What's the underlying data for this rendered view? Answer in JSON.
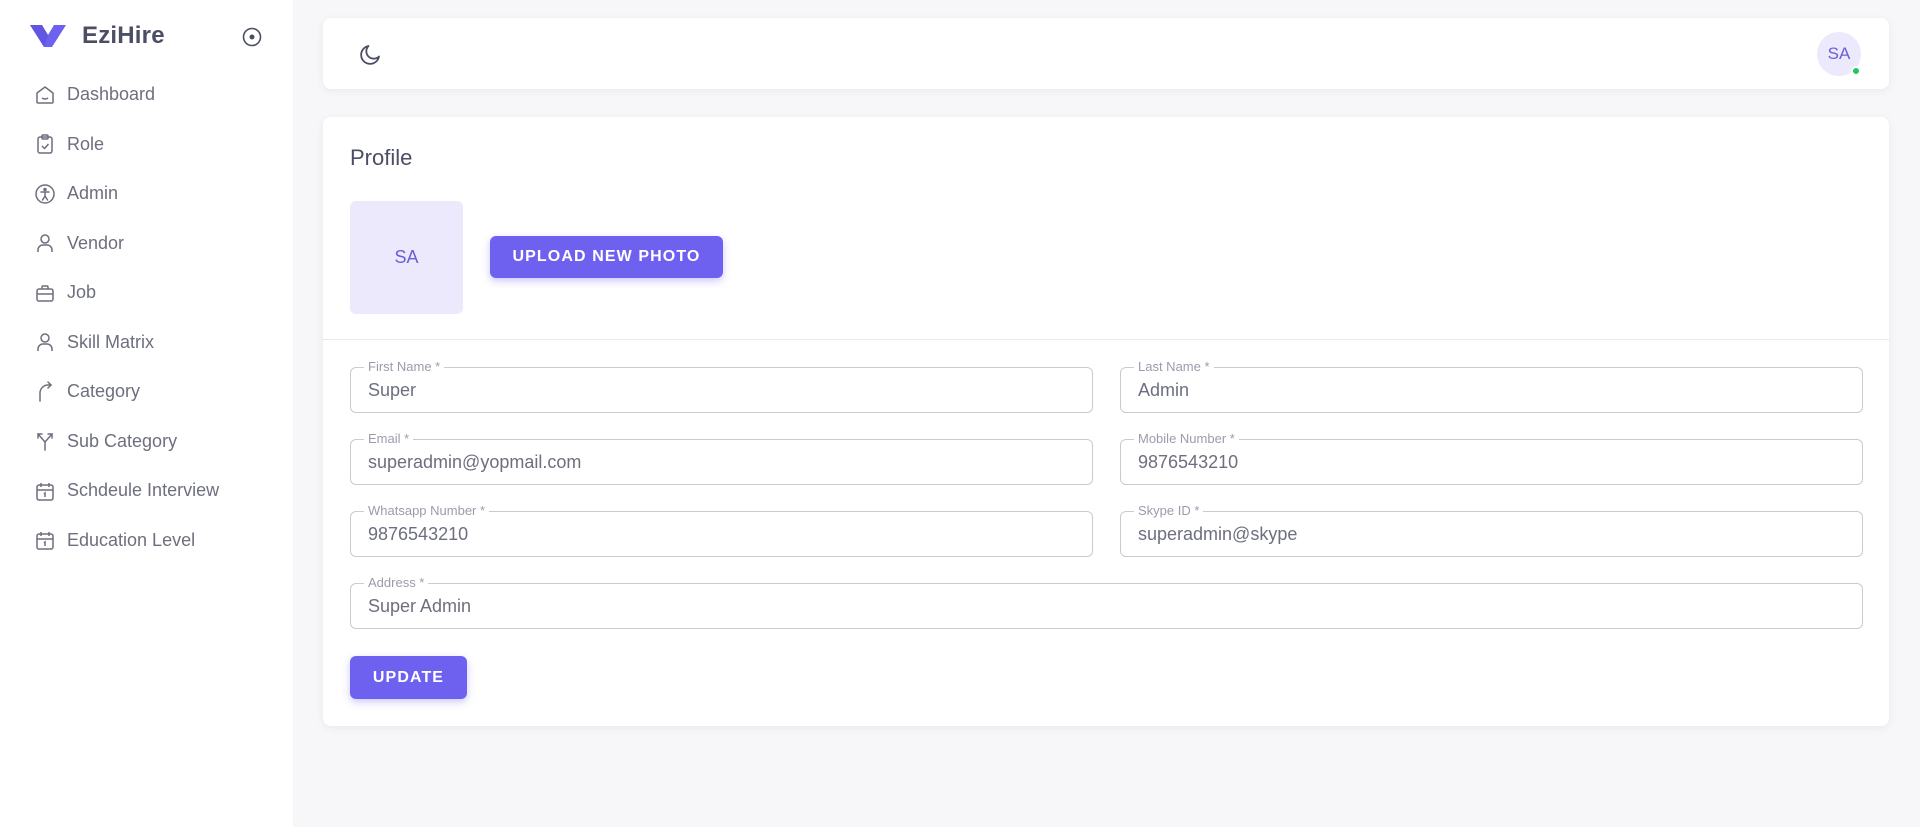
{
  "app": {
    "name": "EziHire"
  },
  "sidebar": {
    "items": [
      {
        "label": "Dashboard",
        "icon": "home-icon"
      },
      {
        "label": "Role",
        "icon": "clipboard-check-icon"
      },
      {
        "label": "Admin",
        "icon": "accessibility-icon"
      },
      {
        "label": "Vendor",
        "icon": "user-icon"
      },
      {
        "label": "Job",
        "icon": "briefcase-icon"
      },
      {
        "label": "Skill Matrix",
        "icon": "user-icon"
      },
      {
        "label": "Category",
        "icon": "arrow-up-right-curve-icon"
      },
      {
        "label": "Sub Category",
        "icon": "arrow-split-icon"
      },
      {
        "label": "Schdeule Interview",
        "icon": "calendar-icon"
      },
      {
        "label": "Education Level",
        "icon": "calendar-icon"
      }
    ]
  },
  "topbar": {
    "theme_icon": "moon-icon",
    "avatar_initials": "SA",
    "status_color": "#22c55e"
  },
  "profile": {
    "title": "Profile",
    "photo_initials": "SA",
    "upload_label": "UPLOAD NEW PHOTO",
    "update_label": "UPDATE",
    "fields": {
      "first_name": {
        "label": "First Name *",
        "value": "Super"
      },
      "last_name": {
        "label": "Last Name *",
        "value": "Admin"
      },
      "email": {
        "label": "Email *",
        "value": "superadmin@yopmail.com"
      },
      "mobile": {
        "label": "Mobile Number *",
        "value": "9876543210"
      },
      "whatsapp": {
        "label": "Whatsapp Number *",
        "value": "9876543210"
      },
      "skype": {
        "label": "Skype ID *",
        "value": "superadmin@skype"
      },
      "address": {
        "label": "Address *",
        "value": "Super Admin"
      }
    }
  },
  "colors": {
    "accent": "#6f61f0",
    "avatar_bg": "#ebe9fb",
    "page_bg": "#f7f7f9"
  }
}
